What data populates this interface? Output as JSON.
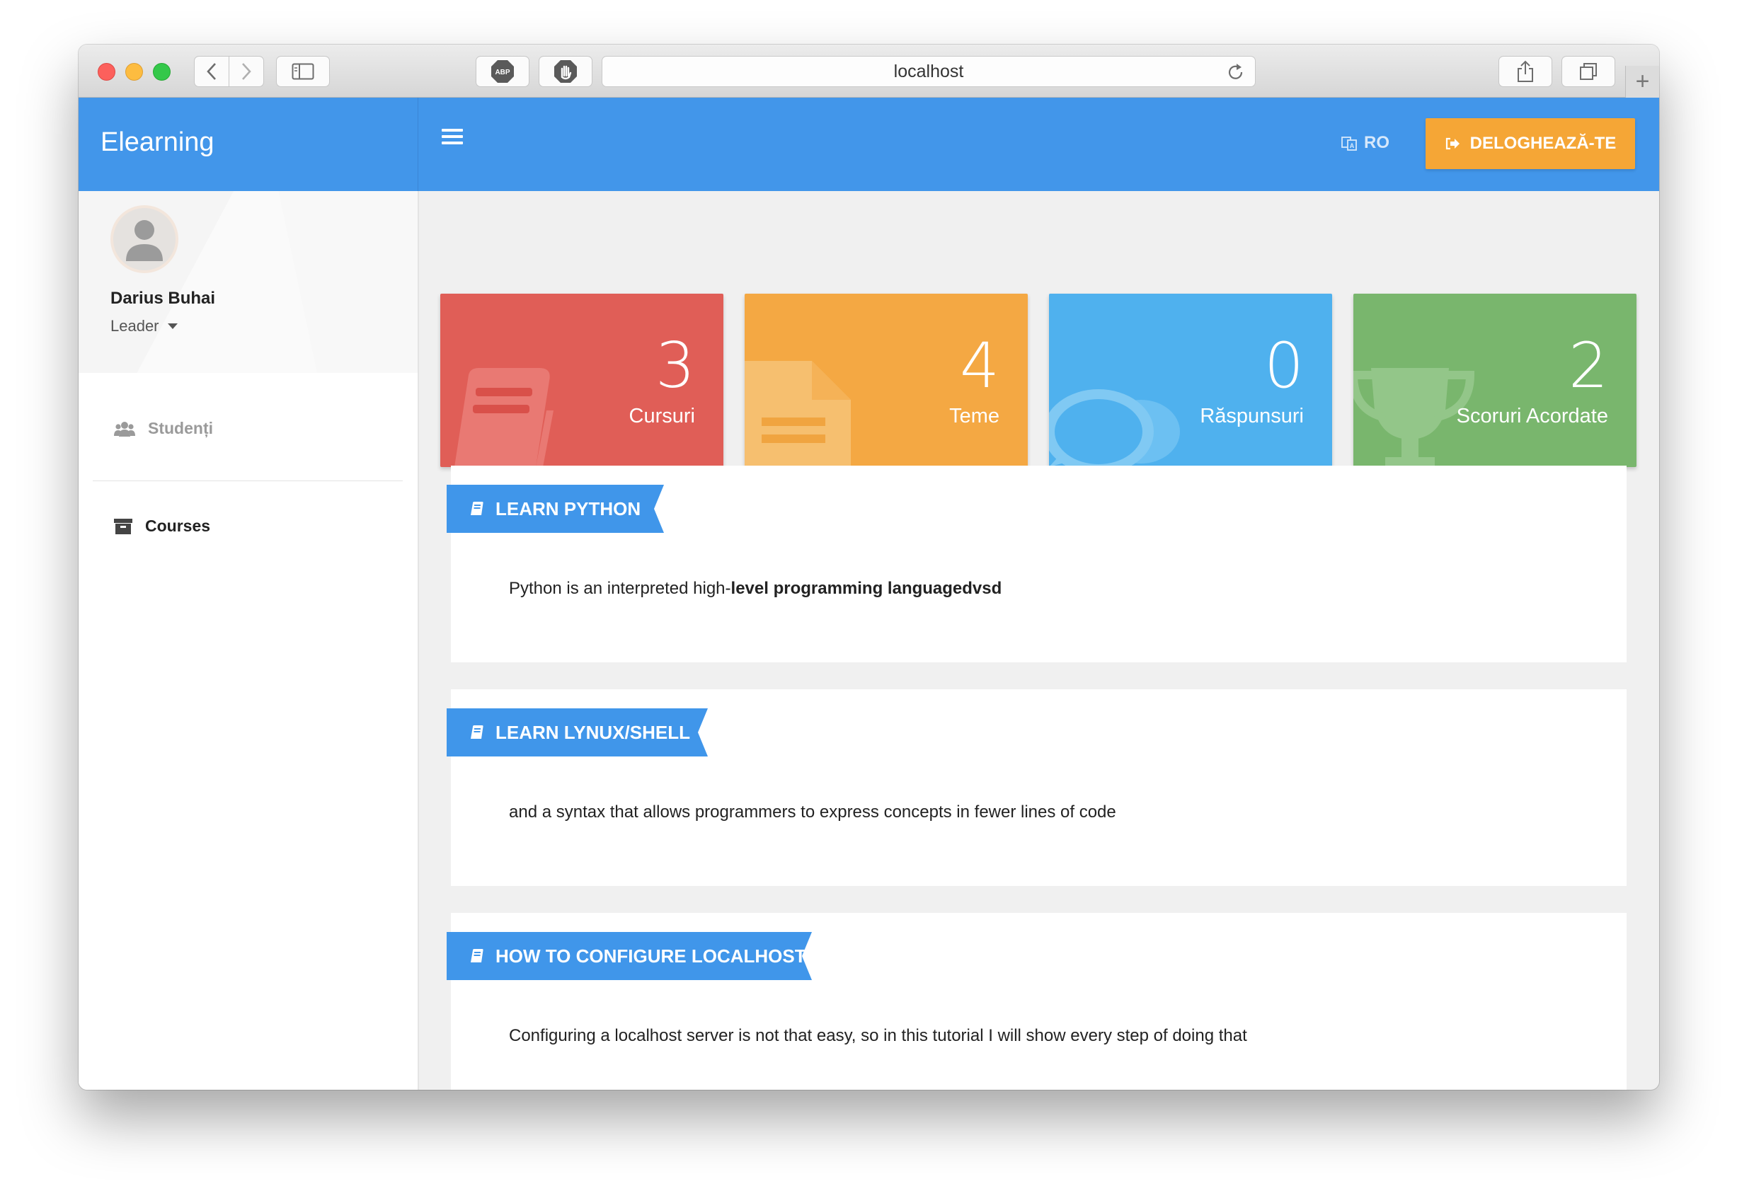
{
  "browser": {
    "url": "localhost",
    "new_tab": "+"
  },
  "header": {
    "brand": "Elearning",
    "language": "RO",
    "logout_label": "DELOGHEAZĂ-TE"
  },
  "sidebar": {
    "user_name": "Darius Buhai",
    "user_role": "Leader",
    "items": [
      {
        "label": "Studenți",
        "icon": "users-icon"
      },
      {
        "label": "Courses",
        "icon": "archive-icon"
      }
    ]
  },
  "stats": [
    {
      "value": "3",
      "label": "Cursuri",
      "color": "#e05e57",
      "icon": "book-icon"
    },
    {
      "value": "4",
      "label": "Teme",
      "color": "#f4a843",
      "icon": "document-icon"
    },
    {
      "value": "0",
      "label": "Răspunsuri",
      "color": "#4fb1ee",
      "icon": "chat-icon"
    },
    {
      "value": "2",
      "label": "Scoruri Acordate",
      "color": "#79b66d",
      "icon": "trophy-icon"
    }
  ],
  "courses": [
    {
      "title": "LEARN PYTHON",
      "description_plain": "Python is an interpreted high-",
      "description_bold": "level programming languagedvsd"
    },
    {
      "title": "LEARN LYNUX/SHELL",
      "description_plain": "and a syntax that allows programmers to express concepts in fewer lines of code",
      "description_bold": ""
    },
    {
      "title": "HOW TO CONFIGURE LOCALHOST",
      "description_plain": "Configuring a localhost server is not that easy, so in this tutorial I will show every step of doing that",
      "description_bold": ""
    }
  ],
  "colors": {
    "primary": "#4296ea",
    "accent": "#f5a636"
  }
}
